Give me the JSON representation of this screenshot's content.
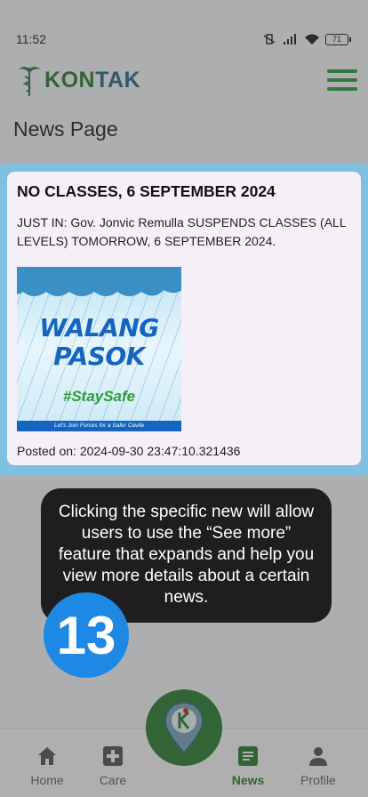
{
  "status": {
    "time": "11:52",
    "battery": "71"
  },
  "app": {
    "logo_k": "K",
    "logo_on": "ON",
    "logo_tak": "TAK"
  },
  "page": {
    "title": "News Page"
  },
  "news": [
    {
      "title": "NO CLASSES, 6 SEPTEMBER 2024",
      "body": "JUST IN: Gov. Jonvic Remulla SUSPENDS CLASSES (ALL LEVELS) TOMORROW, 6 SEPTEMBER 2024.",
      "image": {
        "line1": "WALANG",
        "line2": "PASOK",
        "tag": "#StaySafe",
        "footer": "Let's Join Forces for a Safer Cavite"
      },
      "posted": "Posted on: 2024-09-30 23:47:10.321436"
    }
  ],
  "tutorial": {
    "text": "Clicking the specific new will allow users to use the “See more” feature that expands and help you view more details about a certain news.",
    "step": "13"
  },
  "nav": {
    "home": "Home",
    "care": "Care",
    "news": "News",
    "profile": "Profile"
  },
  "colors": {
    "brand_green": "#2e7d32",
    "accent_blue": "#1e88e5",
    "highlight": "#7fbfe0"
  }
}
